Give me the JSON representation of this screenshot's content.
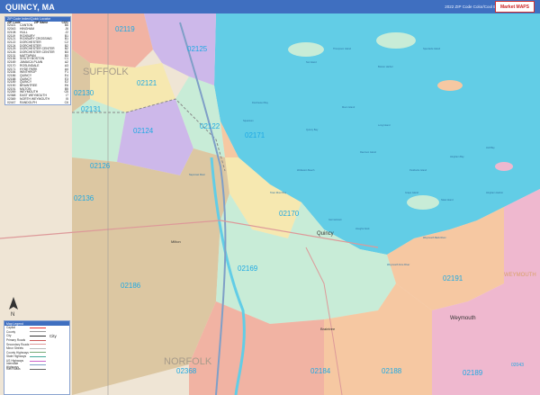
{
  "title": "QUINCY, MA",
  "edition": "2022 ZIP Code Color/Cool Edition",
  "logo": "Market MAPS",
  "zip_legend": {
    "heading": "ZIP Code Index/Quick Locator",
    "columns": [
      "ZIP Code",
      "ZIP Name",
      "COC"
    ],
    "rows": [
      [
        "02021",
        "CANTON",
        "B6"
      ],
      [
        "02043",
        "HINGHAM",
        "J6"
      ],
      [
        "02108",
        "HULL",
        "J2"
      ],
      [
        "02119",
        "ROXBURY",
        "B1"
      ],
      [
        "02121",
        "ROXBURY CROSSING",
        "B1"
      ],
      [
        "02122",
        "DORCHESTER",
        "C2"
      ],
      [
        "02124",
        "DORCHESTER",
        "B2"
      ],
      [
        "02125",
        "DORCHESTER CENTER",
        "B2"
      ],
      [
        "02126",
        "DORCHESTER CENTER",
        "B3"
      ],
      [
        "02131",
        "MATTAPAN",
        "B3"
      ],
      [
        "02136",
        "SOUTH BOSTON",
        "C1"
      ],
      [
        "02169",
        "JAMAICA PLAIN",
        "A2"
      ],
      [
        "02170",
        "ROSLINDALE",
        "A3"
      ],
      [
        "02171",
        "HYDE PARK",
        "A4"
      ],
      [
        "02184",
        "WINTHROP",
        "F1"
      ],
      [
        "02186",
        "QUINCY",
        "E4"
      ],
      [
        "02188",
        "QUINCY",
        "E3"
      ],
      [
        "02189",
        "QUINCY",
        "E2"
      ],
      [
        "02190",
        "BRAINTREE",
        "E6"
      ],
      [
        "02191",
        "MILTON",
        "B5"
      ],
      [
        "02269",
        "WEYMOUTH",
        "G5"
      ],
      [
        "02368",
        "EAST WEYMOUTH",
        "I7"
      ],
      [
        "02369",
        "NORTH WEYMOUTH",
        "I5"
      ],
      [
        "02447",
        "RANDOLPH",
        "C6"
      ]
    ]
  },
  "map_legend": {
    "heading": "Map Legend",
    "items": [
      "Capital",
      "County",
      "City",
      "Primary Roads",
      "Secondary Roads",
      "Minor Streets",
      "County Highways",
      "State Highways",
      "US Highways",
      "Interstate Highways",
      "Rail Roads"
    ],
    "city_label": "City"
  },
  "map": {
    "zip_labels": [
      "02119",
      "02125",
      "02121",
      "02130",
      "02131",
      "02124",
      "02122",
      "02171",
      "02126",
      "02136",
      "02170",
      "02186",
      "02169",
      "02191",
      "02184",
      "02188",
      "02189",
      "02368",
      "02043"
    ],
    "county_labels": [
      "SUFFOLK",
      "NORFOLK"
    ],
    "places": [
      "Quincy",
      "Milton",
      "Braintree",
      "Weymouth",
      "WEYMOUTH"
    ],
    "water_labels": [
      "Dorchester Bay",
      "Quincy Bay",
      "Hingham Bay",
      "Boston Harbor",
      "Neponset River",
      "Town River Bay",
      "Moon Island",
      "Long Island",
      "Peddocks Island",
      "Raccoon Island",
      "Grape Island",
      "Slate Island",
      "Hull Bay",
      "Wollaston Beach",
      "Nut Island",
      "Germantown",
      "Houghs Neck",
      "Squantum",
      "Weymouth Back River",
      "Weymouth Fore River",
      "Hingham Harbor",
      "Thompson Island",
      "Spectacle Island"
    ],
    "colors": {
      "water": "#62cde6",
      "lavender": "#cdb8ea",
      "salmon": "#f1b3a3",
      "mint": "#c8ecd7",
      "peach": "#f6c8a2",
      "pale_yellow": "#f6e8b0",
      "tan": "#dcc7a2",
      "pink": "#efb8cf",
      "zip_label": "#1fa9e3"
    }
  }
}
